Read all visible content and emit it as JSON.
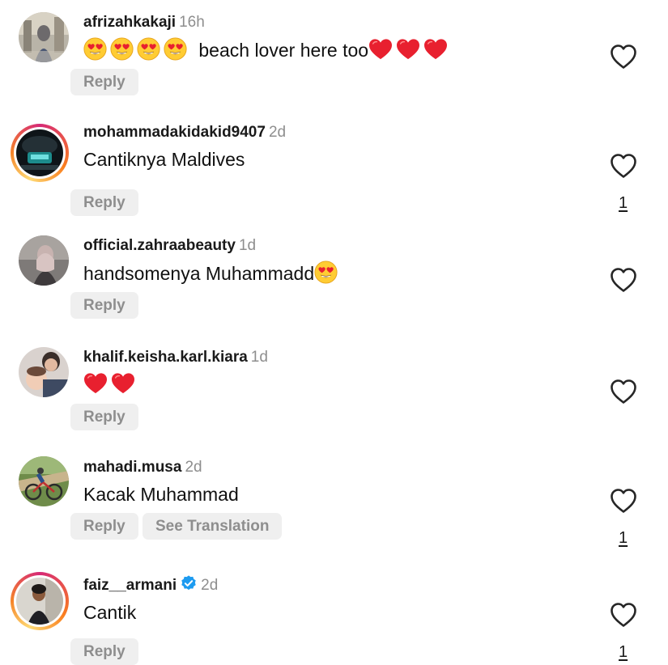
{
  "icons": {
    "like": "heart-outline-icon",
    "heart_emoji": "red-heart-emoji",
    "heart_eyes_emoji": "smiling-face-with-heart-eyes-emoji",
    "verified": "verified-badge-icon"
  },
  "colors": {
    "meta_grey": "#8e8e8e",
    "chip_bg": "#efefef",
    "verified_blue": "#1d9bf0",
    "heart_red": "#e8202f",
    "story_ring": [
      "#d62976",
      "#fa7e1e",
      "#feda75"
    ]
  },
  "comments": [
    {
      "username": "afrizahkakaji",
      "time": "16h",
      "text": "beach lover here too",
      "reply_label": "Reply"
    },
    {
      "username": "mohammadakidakid9407",
      "time": "2d",
      "text": "Cantiknya Maldives",
      "reply_label": "Reply",
      "likes": "1"
    },
    {
      "username": "official.zahraabeauty",
      "time": "1d",
      "text": "handsomenya Muhammadd",
      "reply_label": "Reply"
    },
    {
      "username": "khalif.keisha.karl.kiara",
      "time": "1d",
      "text": "",
      "reply_label": "Reply"
    },
    {
      "username": "mahadi.musa",
      "time": "2d",
      "text": "Kacak Muhammad",
      "reply_label": "Reply",
      "translate_label": "See Translation",
      "likes": "1"
    },
    {
      "username": "faiz__armani",
      "time": "2d",
      "text": "Cantik",
      "reply_label": "Reply",
      "likes": "1",
      "verified": true
    }
  ]
}
